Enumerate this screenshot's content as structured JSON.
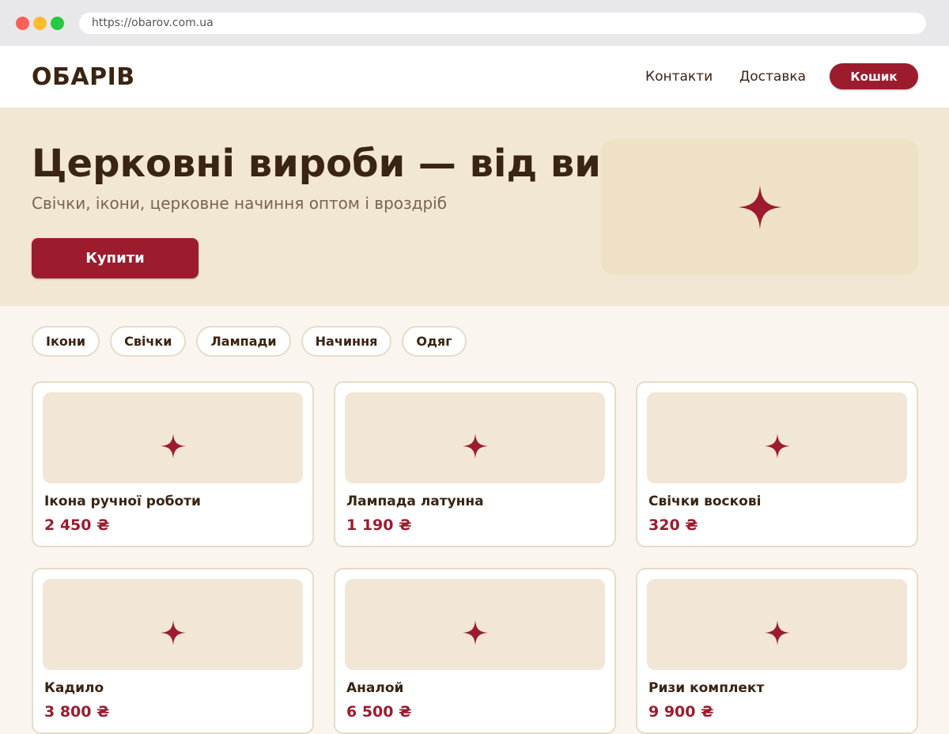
{
  "browser": {
    "url": "https://obarov.com.ua"
  },
  "header": {
    "logo": "ОБАРІВ",
    "nav": {
      "contacts": "Контакти",
      "delivery": "Доставка"
    },
    "cart_label": "Кошик"
  },
  "hero": {
    "title": "Церковні вироби — від виробника",
    "subtitle": "Свічки, ікони, церковне начиння оптом і вроздріб",
    "cta_label": "Купити",
    "image_icon": "star-icon"
  },
  "categories": [
    "Ікони",
    "Свічки",
    "Лампади",
    "Начиння",
    "Одяг"
  ],
  "products": [
    {
      "name": "Ікона ручної роботи",
      "price": "2 450 ₴",
      "icon": "star-icon"
    },
    {
      "name": "Лампада латунна",
      "price": "1 190 ₴",
      "icon": "star-icon"
    },
    {
      "name": "Свічки воскові",
      "price": "320 ₴",
      "icon": "star-icon"
    },
    {
      "name": "Кадило",
      "price": "3 800 ₴",
      "icon": "star-icon"
    },
    {
      "name": "Аналой",
      "price": "6 500 ₴",
      "icon": "star-icon"
    },
    {
      "name": "Ризи комплект",
      "price": "9 900 ₴",
      "icon": "star-icon"
    }
  ],
  "colors": {
    "accent": "#9c1c2e",
    "text": "#3a2412",
    "hero_bg": "#f2e7d3",
    "page_bg": "#faf5ee",
    "card_border": "#e6dcc8"
  }
}
